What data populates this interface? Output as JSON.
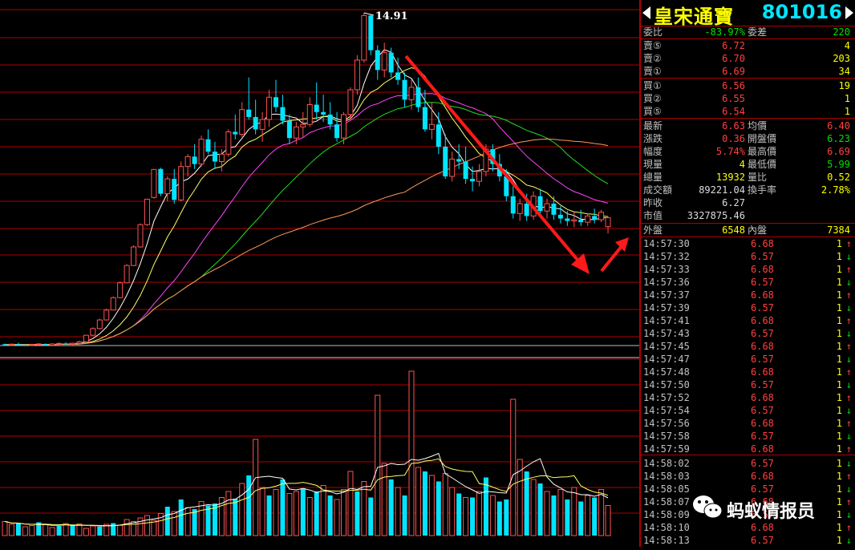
{
  "stock": {
    "name": "皇宋通寶",
    "code": "801016"
  },
  "chart": {
    "peak_label": "14.91",
    "candles": [
      [
        1.52,
        1.54,
        1.46,
        1.5
      ],
      [
        1.5,
        1.55,
        1.45,
        1.52
      ],
      [
        1.52,
        1.58,
        1.47,
        1.5
      ],
      [
        1.5,
        1.53,
        1.44,
        1.49
      ],
      [
        1.49,
        1.54,
        1.46,
        1.51
      ],
      [
        1.51,
        1.56,
        1.47,
        1.53
      ],
      [
        1.53,
        1.55,
        1.46,
        1.48
      ],
      [
        1.48,
        1.56,
        1.45,
        1.53
      ],
      [
        1.53,
        1.59,
        1.48,
        1.55
      ],
      [
        1.55,
        1.6,
        1.5,
        1.52
      ],
      [
        1.52,
        1.58,
        1.47,
        1.56
      ],
      [
        1.56,
        1.66,
        1.52,
        1.62
      ],
      [
        1.62,
        1.9,
        1.6,
        1.88
      ],
      [
        1.88,
        2.2,
        1.85,
        2.15
      ],
      [
        2.15,
        2.55,
        2.12,
        2.5
      ],
      [
        2.5,
        2.95,
        2.48,
        2.9
      ],
      [
        2.9,
        3.45,
        2.88,
        3.4
      ],
      [
        3.4,
        4.05,
        3.38,
        4.0
      ],
      [
        4.0,
        4.75,
        3.98,
        4.7
      ],
      [
        4.7,
        5.52,
        4.68,
        5.45
      ],
      [
        5.45,
        6.4,
        5.42,
        6.35
      ],
      [
        6.35,
        7.4,
        6.3,
        7.38
      ],
      [
        7.45,
        8.6,
        7.4,
        8.58
      ],
      [
        8.6,
        8.65,
        7.5,
        7.6
      ],
      [
        7.6,
        8.3,
        7.3,
        8.2
      ],
      [
        8.2,
        8.6,
        7.2,
        7.35
      ],
      [
        7.35,
        8.9,
        7.3,
        8.7
      ],
      [
        8.7,
        9.2,
        8.3,
        9.1
      ],
      [
        9.1,
        9.6,
        8.6,
        8.8
      ],
      [
        8.8,
        9.95,
        8.7,
        9.8
      ],
      [
        9.8,
        10.2,
        9.2,
        9.3
      ],
      [
        9.3,
        9.7,
        8.6,
        8.9
      ],
      [
        8.9,
        9.4,
        8.5,
        9.2
      ],
      [
        9.2,
        10.2,
        9.1,
        10.1
      ],
      [
        10.1,
        10.8,
        9.8,
        10.0
      ],
      [
        10.0,
        11.3,
        9.9,
        11.0
      ],
      [
        11.0,
        12.3,
        10.6,
        10.7
      ],
      [
        10.7,
        11.4,
        10.0,
        10.2
      ],
      [
        10.2,
        10.9,
        9.7,
        10.6
      ],
      [
        10.6,
        11.8,
        10.3,
        11.5
      ],
      [
        11.5,
        12.2,
        10.9,
        11.1
      ],
      [
        11.1,
        11.6,
        10.4,
        10.55
      ],
      [
        10.55,
        10.8,
        9.6,
        9.85
      ],
      [
        9.85,
        10.5,
        9.6,
        10.3
      ],
      [
        10.3,
        10.9,
        9.9,
        10.4
      ],
      [
        10.4,
        11.5,
        10.3,
        11.2
      ],
      [
        11.2,
        12.1,
        10.6,
        10.9
      ],
      [
        10.9,
        11.6,
        10.5,
        10.8
      ],
      [
        10.8,
        11.3,
        10.2,
        10.4
      ],
      [
        10.4,
        10.9,
        9.7,
        9.85
      ],
      [
        9.85,
        10.9,
        9.6,
        10.8
      ],
      [
        10.8,
        11.9,
        10.6,
        11.8
      ],
      [
        11.8,
        13.2,
        11.6,
        13.0
      ],
      [
        13.0,
        14.91,
        12.9,
        14.8
      ],
      [
        14.8,
        14.85,
        13.2,
        13.4
      ],
      [
        13.4,
        13.6,
        12.2,
        12.6
      ],
      [
        12.6,
        13.7,
        12.3,
        13.3
      ],
      [
        13.3,
        13.5,
        12.3,
        12.5
      ],
      [
        12.5,
        13.1,
        12.0,
        12.2
      ],
      [
        12.2,
        12.5,
        11.1,
        11.4
      ],
      [
        11.4,
        12.2,
        11.0,
        11.9
      ],
      [
        11.9,
        12.3,
        10.9,
        11.1
      ],
      [
        11.1,
        11.8,
        10.1,
        10.2
      ],
      [
        10.2,
        11.3,
        9.8,
        10.4
      ],
      [
        10.4,
        10.9,
        9.2,
        9.5
      ],
      [
        9.5,
        10.0,
        8.2,
        8.3
      ],
      [
        8.3,
        9.3,
        8.1,
        9.0
      ],
      [
        9.0,
        9.6,
        8.6,
        8.9
      ],
      [
        8.9,
        9.5,
        8.0,
        8.2
      ],
      [
        8.2,
        8.7,
        7.7,
        8.1
      ],
      [
        8.1,
        8.8,
        7.9,
        8.5
      ],
      [
        8.5,
        9.6,
        8.3,
        9.4
      ],
      [
        9.4,
        9.6,
        8.5,
        8.8
      ],
      [
        8.8,
        9.2,
        8.1,
        8.3
      ],
      [
        8.3,
        8.6,
        7.3,
        7.5
      ],
      [
        7.5,
        7.9,
        6.6,
        6.8
      ],
      [
        6.8,
        7.4,
        6.5,
        7.2
      ],
      [
        7.2,
        7.6,
        6.5,
        6.7
      ],
      [
        6.7,
        7.7,
        6.55,
        7.5
      ],
      [
        7.5,
        7.8,
        6.7,
        6.9
      ],
      [
        6.9,
        7.4,
        6.6,
        7.2
      ],
      [
        7.2,
        7.5,
        6.55,
        6.75
      ],
      [
        6.75,
        7.1,
        6.4,
        6.6
      ],
      [
        6.6,
        6.9,
        6.3,
        6.5
      ],
      [
        6.5,
        6.85,
        6.25,
        6.55
      ],
      [
        6.55,
        6.95,
        6.3,
        6.45
      ],
      [
        6.45,
        6.8,
        6.3,
        6.7
      ],
      [
        6.7,
        7.0,
        6.4,
        6.55
      ],
      [
        6.55,
        6.95,
        6.45,
        6.85
      ],
      [
        6.27,
        6.69,
        5.99,
        6.63
      ]
    ],
    "volumes": [
      35,
      28,
      30,
      22,
      25,
      33,
      27,
      20,
      24,
      30,
      26,
      29,
      18,
      24,
      22,
      28,
      31,
      26,
      40,
      35,
      44,
      50,
      38,
      55,
      72,
      60,
      90,
      70,
      66,
      85,
      75,
      80,
      95,
      110,
      92,
      130,
      150,
      240,
      120,
      100,
      115,
      140,
      105,
      110,
      118,
      95,
      110,
      125,
      100,
      90,
      115,
      160,
      110,
      135,
      95,
      350,
      180,
      140,
      120,
      100,
      410,
      170,
      160,
      150,
      135,
      155,
      120,
      105,
      95,
      95,
      110,
      145,
      100,
      85,
      90,
      340,
      190,
      160,
      140,
      130,
      110,
      100,
      115,
      90,
      120,
      85,
      100,
      95,
      115,
      75
    ],
    "volume_up": [
      1,
      1,
      0,
      1,
      1,
      0,
      1,
      1,
      0,
      1,
      0,
      1,
      1,
      1,
      0,
      1,
      0,
      1,
      1,
      1,
      1,
      1,
      1,
      1,
      0,
      1,
      0,
      1,
      0,
      1,
      0,
      0,
      1,
      1,
      0,
      1,
      0,
      1,
      1,
      0,
      1,
      0,
      1,
      1,
      0,
      1,
      0,
      1,
      0,
      1,
      1,
      1,
      0,
      1,
      0,
      1,
      1,
      0,
      1,
      0,
      1,
      1,
      0,
      1,
      0,
      1,
      1,
      0,
      1,
      0,
      1,
      0,
      1,
      0,
      0,
      1,
      1,
      0,
      1,
      0,
      1,
      0,
      1,
      0,
      1,
      0,
      1,
      0,
      1,
      1
    ]
  },
  "panel": {
    "wb": {
      "label": "委比",
      "value": "-83.97%",
      "label2": "委差",
      "value2": "220"
    },
    "sells": [
      {
        "label": "賣⑤",
        "price": "6.72",
        "vol": "4"
      },
      {
        "label": "賣②",
        "price": "6.70",
        "vol": "203"
      },
      {
        "label": "賣①",
        "price": "6.69",
        "vol": "34"
      }
    ],
    "buys": [
      {
        "label": "買①",
        "price": "6.56",
        "vol": "19"
      },
      {
        "label": "買②",
        "price": "6.55",
        "vol": "1"
      },
      {
        "label": "買⑤",
        "price": "6.54",
        "vol": "1"
      }
    ],
    "stats": [
      {
        "l1": "最新",
        "v1": "6.63",
        "c1": "red",
        "l2": "均價",
        "v2": "6.40",
        "c2": "red"
      },
      {
        "l1": "漲跌",
        "v1": "0.36",
        "c1": "red",
        "l2": "開盤價",
        "v2": "6.23",
        "c2": "green"
      },
      {
        "l1": "幅度",
        "v1": "5.74%",
        "c1": "red",
        "l2": "最高價",
        "v2": "6.69",
        "c2": "red"
      },
      {
        "l1": "現量",
        "v1": "4",
        "c1": "yellow",
        "l2": "最低價",
        "v2": "5.99",
        "c2": "green"
      },
      {
        "l1": "總量",
        "v1": "13932",
        "c1": "yellow",
        "l2": "量比",
        "v2": "0.52",
        "c2": "yellow"
      },
      {
        "l1": "成交額",
        "v1": "89221.04",
        "c1": "white",
        "l2": "換手率",
        "v2": "2.78%",
        "c2": "yellow"
      },
      {
        "l1": "昨收",
        "v1": "6.27",
        "c1": "white",
        "l2": "",
        "v2": "",
        "c2": "white"
      },
      {
        "l1": "市值",
        "v1": "3327875.46",
        "c1": "white",
        "l2": "",
        "v2": "",
        "c2": "white"
      }
    ],
    "outer": {
      "label": "外盤",
      "value": "6548",
      "label2": "內盤",
      "value2": "7384"
    },
    "ticks": [
      {
        "t": "14:57:30",
        "p": "6.68",
        "v": "1",
        "d": "up"
      },
      {
        "t": "14:57:32",
        "p": "6.57",
        "v": "1",
        "d": "down"
      },
      {
        "t": "14:57:33",
        "p": "6.68",
        "v": "1",
        "d": "up"
      },
      {
        "t": "14:57:36",
        "p": "6.57",
        "v": "1",
        "d": "down"
      },
      {
        "t": "14:57:37",
        "p": "6.68",
        "v": "1",
        "d": "up"
      },
      {
        "t": "14:57:39",
        "p": "6.57",
        "v": "1",
        "d": "down"
      },
      {
        "t": "14:57:41",
        "p": "6.68",
        "v": "1",
        "d": "up"
      },
      {
        "t": "14:57:43",
        "p": "6.57",
        "v": "1",
        "d": "down"
      },
      {
        "t": "14:57:45",
        "p": "6.68",
        "v": "1",
        "d": "up"
      },
      {
        "t": "14:57:47",
        "p": "6.57",
        "v": "1",
        "d": "down"
      },
      {
        "t": "14:57:48",
        "p": "6.68",
        "v": "1",
        "d": "up"
      },
      {
        "t": "14:57:50",
        "p": "6.57",
        "v": "1",
        "d": "down"
      },
      {
        "t": "14:57:52",
        "p": "6.68",
        "v": "1",
        "d": "up"
      },
      {
        "t": "14:57:54",
        "p": "6.57",
        "v": "1",
        "d": "down"
      },
      {
        "t": "14:57:56",
        "p": "6.68",
        "v": "1",
        "d": "up"
      },
      {
        "t": "14:57:58",
        "p": "6.57",
        "v": "1",
        "d": "down"
      },
      {
        "t": "14:57:59",
        "p": "6.68",
        "v": "1",
        "d": "up"
      },
      {
        "t": "14:58:02",
        "p": "6.57",
        "v": "1",
        "d": "down"
      },
      {
        "t": "14:58:03",
        "p": "6.68",
        "v": "1",
        "d": "up"
      },
      {
        "t": "14:58:05",
        "p": "6.57",
        "v": "1",
        "d": "down"
      },
      {
        "t": "14:58:07",
        "p": "6.68",
        "v": "1",
        "d": "up"
      },
      {
        "t": "14:58:09",
        "p": "6.57",
        "v": "1",
        "d": "down"
      },
      {
        "t": "14:58:10",
        "p": "6.68",
        "v": "1",
        "d": "up"
      },
      {
        "t": "14:58:13",
        "p": "6.57",
        "v": "1",
        "d": "down"
      }
    ]
  },
  "watermark": {
    "text": "蚂蚁情报员"
  },
  "colors": {
    "up": "#ff5252",
    "down": "#00e5ff",
    "grid": "#b00000",
    "ma5": "#ffffff",
    "ma10": "#ffff66",
    "ma20": "#ff44ff",
    "ma30": "#22dd22",
    "ma60": "#ff9955",
    "arrow": "#ff1a1a"
  }
}
